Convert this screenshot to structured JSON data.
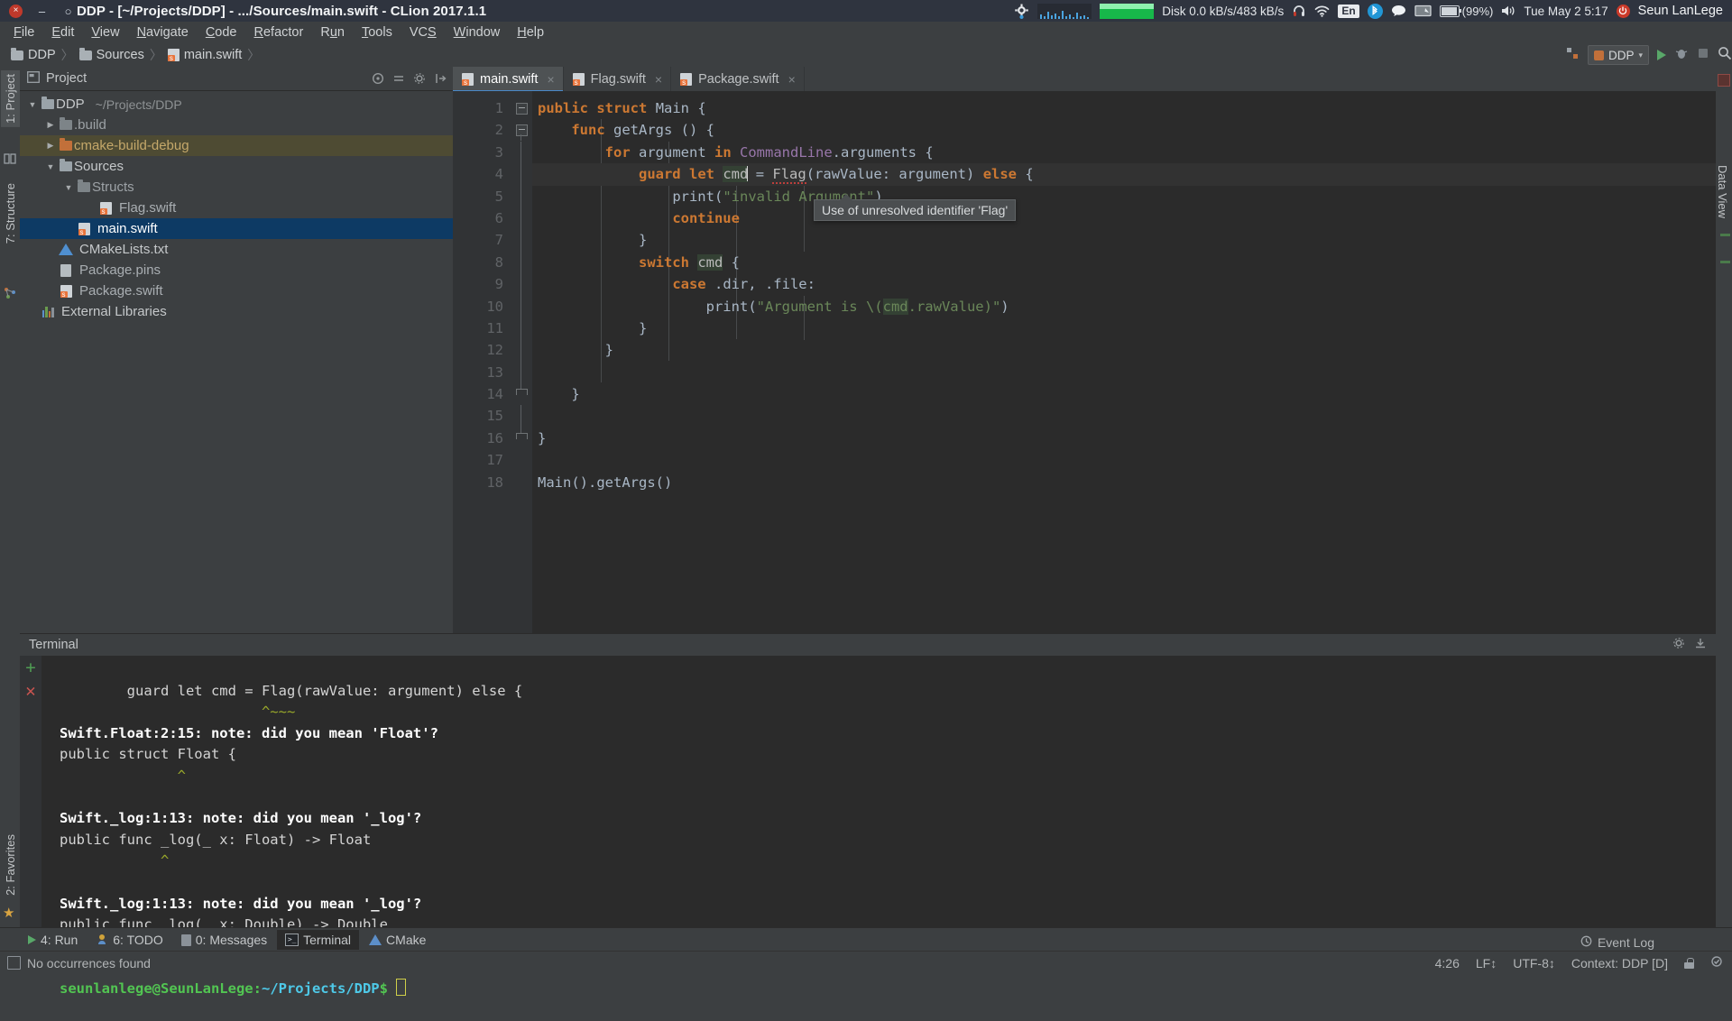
{
  "window": {
    "title": "DDP - [~/Projects/DDP] - .../Sources/main.swift - CLion 2017.1.1",
    "close_glyph": "×",
    "minimize_glyph": "–",
    "maximize_glyph": "○"
  },
  "systray": {
    "disk_label": "Disk 0.0 kB/s/483 kB/s",
    "keyboard_layout": "En",
    "battery_percent": "(99%)",
    "datetime": "Tue May  2  5:17",
    "user": "Seun LanLege",
    "icons": {
      "settings": "gear-icon",
      "network_graph": "network-graph-icon",
      "disk_graph": "disk-graph-icon",
      "headphone": "headphone-icon",
      "wifi": "wifi-icon",
      "bluetooth": "bluetooth-icon",
      "notification": "notification-bubble-icon",
      "display": "display-icon",
      "volume": "volume-icon",
      "power": "power-icon"
    }
  },
  "menubar": {
    "items": [
      {
        "label": "File",
        "mnemonic": "F"
      },
      {
        "label": "Edit",
        "mnemonic": "E"
      },
      {
        "label": "View",
        "mnemonic": "V"
      },
      {
        "label": "Navigate",
        "mnemonic": "N"
      },
      {
        "label": "Code",
        "mnemonic": "C"
      },
      {
        "label": "Refactor",
        "mnemonic": "R"
      },
      {
        "label": "Run",
        "mnemonic": "u"
      },
      {
        "label": "Tools",
        "mnemonic": "T"
      },
      {
        "label": "VCS",
        "mnemonic": "S"
      },
      {
        "label": "Window",
        "mnemonic": "W"
      },
      {
        "label": "Help",
        "mnemonic": "H"
      }
    ]
  },
  "navbar": {
    "crumbs": [
      {
        "label": "DDP",
        "icon": "folder-icon"
      },
      {
        "label": "Sources",
        "icon": "folder-icon"
      },
      {
        "label": "main.swift",
        "icon": "swift-file-icon"
      }
    ],
    "separator": "〉",
    "run_config": "DDP",
    "run_config_caret": "▾",
    "buttons": [
      "run-button",
      "debug-button",
      "stop-button",
      "search-everywhere-button"
    ]
  },
  "left_tool_strip": {
    "tabs": [
      {
        "label": "1: Project",
        "selected": true
      },
      {
        "label": "7: Structure",
        "selected": false
      },
      {
        "label": "2: Favorites",
        "selected": false
      }
    ]
  },
  "right_tool_strip": {
    "tabs": [
      {
        "label": "Data View"
      }
    ]
  },
  "project_panel": {
    "title": "Project",
    "header_icons": [
      "target-icon",
      "collapse-icon",
      "gear-icon",
      "hide-icon"
    ],
    "tree": [
      {
        "label": "DDP",
        "sub": "~/Projects/DDP",
        "depth": 0,
        "arrow": "▼",
        "icon": "folder-icon",
        "state": "normal"
      },
      {
        "label": ".build",
        "sub": "",
        "depth": 1,
        "arrow": "▶",
        "icon": "folder-dim-icon",
        "state": "normal"
      },
      {
        "label": "cmake-build-debug",
        "sub": "",
        "depth": 1,
        "arrow": "▶",
        "icon": "folder-orange-icon",
        "state": "highlight"
      },
      {
        "label": "Sources",
        "sub": "",
        "depth": 1,
        "arrow": "▼",
        "icon": "folder-icon",
        "state": "normal"
      },
      {
        "label": "Structs",
        "sub": "",
        "depth": 2,
        "arrow": "▼",
        "icon": "folder-dim-icon",
        "state": "normal"
      },
      {
        "label": "Flag.swift",
        "sub": "",
        "depth": 3,
        "arrow": "",
        "icon": "swift-file-icon",
        "state": "normal"
      },
      {
        "label": "main.swift",
        "sub": "",
        "depth": 2,
        "arrow": "",
        "icon": "swift-file-icon",
        "state": "selected"
      },
      {
        "label": "CMakeLists.txt",
        "sub": "",
        "depth": 1,
        "arrow": "",
        "icon": "cmake-icon",
        "state": "normal"
      },
      {
        "label": "Package.pins",
        "sub": "",
        "depth": 1,
        "arrow": "",
        "icon": "pins-file-icon",
        "state": "normal"
      },
      {
        "label": "Package.swift",
        "sub": "",
        "depth": 1,
        "arrow": "",
        "icon": "swift-file-icon",
        "state": "normal"
      },
      {
        "label": "External Libraries",
        "sub": "",
        "depth": 0,
        "arrow": "",
        "icon": "library-icon",
        "state": "normal"
      }
    ]
  },
  "editor": {
    "tabs": [
      {
        "label": "main.swift",
        "active": true,
        "close_glyph": "×",
        "icon": "swift-file-icon"
      },
      {
        "label": "Flag.swift",
        "active": false,
        "close_glyph": "×",
        "icon": "swift-file-icon"
      },
      {
        "label": "Package.swift",
        "active": false,
        "close_glyph": "×",
        "icon": "swift-file-icon"
      }
    ],
    "line_numbers": [
      "1",
      "2",
      "3",
      "4",
      "5",
      "6",
      "7",
      "8",
      "9",
      "10",
      "11",
      "12",
      "13",
      "14",
      "15",
      "16",
      "17",
      "18"
    ],
    "code_lines": [
      "public struct Main {",
      "    func getArgs () {",
      "        for argument in CommandLine.arguments {",
      "            guard let cmd = Flag(rawValue: argument) else {",
      "                print(\"invalid Argument\")",
      "                continue",
      "            }",
      "            switch cmd {",
      "                case .dir, .file:",
      "                    print(\"Argument is \\(cmd.rawValue)\")",
      "            }",
      "        }",
      "",
      "    }",
      "",
      "}",
      "",
      "Main().getArgs()"
    ],
    "current_line": 4,
    "tooltip": "Use of unresolved identifier 'Flag'",
    "error_token": "Flag"
  },
  "terminal": {
    "title": "Terminal",
    "header_icons": [
      "gear-icon",
      "hide-icon"
    ],
    "gutter_icons": [
      "add-icon",
      "close-icon"
    ],
    "lines": [
      {
        "text": "        guard let cmd = Flag(rawValue: argument) else {",
        "style": "plain"
      },
      {
        "text": "                        ^~~~",
        "style": "caret"
      },
      {
        "text": "Swift.Float:2:15: note: did you mean 'Float'?",
        "style": "bold"
      },
      {
        "text": "public struct Float {",
        "style": "plain"
      },
      {
        "text": "              ^",
        "style": "caret"
      },
      {
        "text": "",
        "style": "plain"
      },
      {
        "text": "Swift._log:1:13: note: did you mean '_log'?",
        "style": "bold"
      },
      {
        "text": "public func _log(_ x: Float) -> Float",
        "style": "plain"
      },
      {
        "text": "            ^",
        "style": "caret"
      },
      {
        "text": "",
        "style": "plain"
      },
      {
        "text": "Swift._log:1:13: note: did you mean '_log'?",
        "style": "bold"
      },
      {
        "text": "public func _log(_ x: Double) -> Double",
        "style": "plain"
      },
      {
        "text": "            ^",
        "style": "caret"
      },
      {
        "text": "",
        "style": "plain"
      }
    ],
    "prompt_user": "seunlanlege@SeunLanLege",
    "prompt_sep": ":",
    "prompt_path": "~/Projects/DDP",
    "prompt_symbol": "$"
  },
  "bottom_bar": {
    "tabs": [
      {
        "label": "4: Run",
        "mnemonic": "4",
        "icon": "run-icon",
        "selected": false
      },
      {
        "label": "6: TODO",
        "mnemonic": "6",
        "icon": "todo-icon",
        "selected": false
      },
      {
        "label": "0: Messages",
        "mnemonic": "0",
        "icon": "messages-icon",
        "selected": false
      },
      {
        "label": "Terminal",
        "mnemonic": "",
        "icon": "terminal-icon",
        "selected": true
      },
      {
        "label": "CMake",
        "mnemonic": "",
        "icon": "cmake-icon",
        "selected": false
      }
    ]
  },
  "status_bar": {
    "message": "No occurrences found",
    "caret_position": "4:26",
    "line_separator": "LF↕",
    "encoding": "UTF-8↕",
    "context": "Context: DDP [D]",
    "event_log": "Event Log"
  },
  "colors": {
    "accent_blue": "#4a88c7",
    "selection_blue": "#0d3a64",
    "editor_bg": "#2b2b2b",
    "panel_bg": "#3c3f41",
    "keyword_orange": "#cc7832",
    "string_green": "#6a8759",
    "error_red": "#bc3f3c"
  }
}
